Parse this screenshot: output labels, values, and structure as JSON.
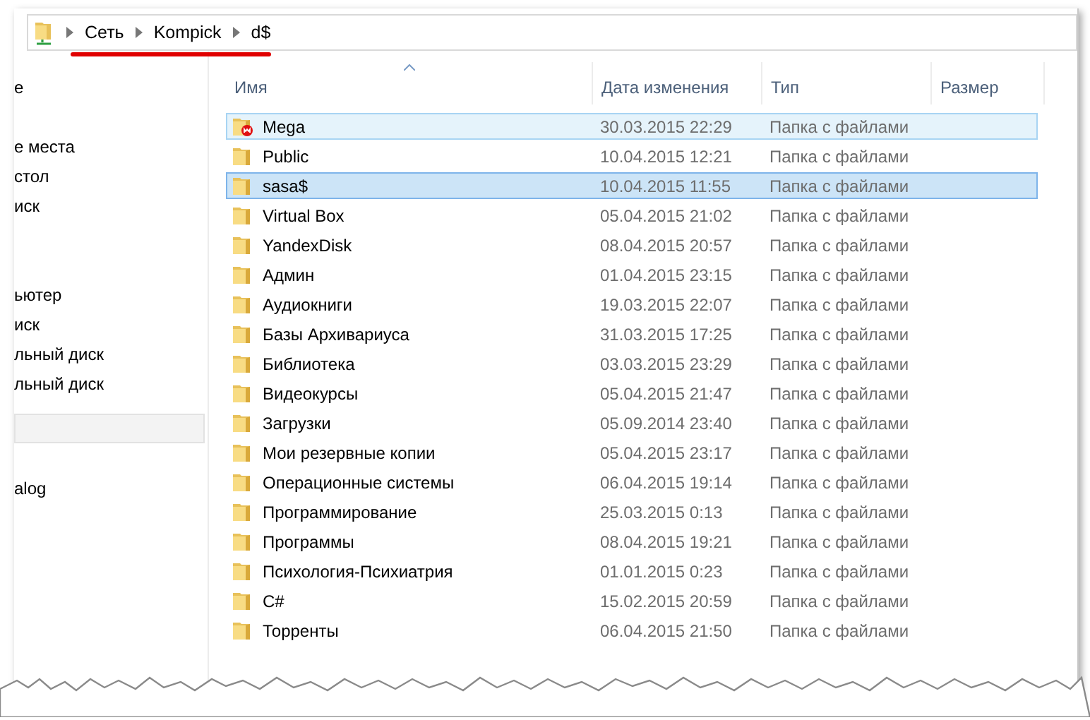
{
  "address_bar": {
    "path": [
      "Сеть",
      "Kompick",
      "d$"
    ]
  },
  "navigation": {
    "items": [
      {
        "label": "е"
      },
      {
        "label": "е места"
      },
      {
        "label": "стол"
      },
      {
        "label": "иск"
      },
      {
        "label": "ьютер"
      },
      {
        "label": "иск"
      },
      {
        "label": "льный диск"
      },
      {
        "label": "льный диск"
      },
      {
        "label": "alog"
      }
    ]
  },
  "table": {
    "columns": [
      {
        "label": "Имя",
        "sorted": true
      },
      {
        "label": "Дата изменения",
        "sorted": false
      },
      {
        "label": "Тип",
        "sorted": false
      },
      {
        "label": "Размер",
        "sorted": false
      }
    ],
    "rows": [
      {
        "name": "Mega",
        "date": "30.03.2015 22:29",
        "type": "Папка с файлами",
        "selected": false,
        "hovered": true,
        "overlay": true
      },
      {
        "name": "Public",
        "date": "10.04.2015 12:21",
        "type": "Папка с файлами",
        "selected": false,
        "hovered": false,
        "overlay": false
      },
      {
        "name": "sasa$",
        "date": "10.04.2015 11:55",
        "type": "Папка с файлами",
        "selected": true,
        "hovered": false,
        "overlay": false
      },
      {
        "name": "Virtual Box",
        "date": "05.04.2015 21:02",
        "type": "Папка с файлами",
        "selected": false,
        "hovered": false,
        "overlay": false
      },
      {
        "name": "YandexDisk",
        "date": "08.04.2015 20:57",
        "type": "Папка с файлами",
        "selected": false,
        "hovered": false,
        "overlay": false
      },
      {
        "name": "Админ",
        "date": "01.04.2015 23:15",
        "type": "Папка с файлами",
        "selected": false,
        "hovered": false,
        "overlay": false
      },
      {
        "name": "Аудиокниги",
        "date": "19.03.2015 22:07",
        "type": "Папка с файлами",
        "selected": false,
        "hovered": false,
        "overlay": false
      },
      {
        "name": "Базы Архивариуса",
        "date": "31.03.2015 17:25",
        "type": "Папка с файлами",
        "selected": false,
        "hovered": false,
        "overlay": false
      },
      {
        "name": "Библиотека",
        "date": "03.03.2015 23:29",
        "type": "Папка с файлами",
        "selected": false,
        "hovered": false,
        "overlay": false
      },
      {
        "name": "Видеокурсы",
        "date": "05.04.2015 21:47",
        "type": "Папка с файлами",
        "selected": false,
        "hovered": false,
        "overlay": false
      },
      {
        "name": "Загрузки",
        "date": "05.09.2014 23:40",
        "type": "Папка с файлами",
        "selected": false,
        "hovered": false,
        "overlay": false
      },
      {
        "name": "Мои резервные копии",
        "date": "05.04.2015 23:17",
        "type": "Папка с файлами",
        "selected": false,
        "hovered": false,
        "overlay": false
      },
      {
        "name": "Операционные системы",
        "date": "06.04.2015 19:14",
        "type": "Папка с файлами",
        "selected": false,
        "hovered": false,
        "overlay": false
      },
      {
        "name": "Программирование",
        "date": "25.03.2015 0:13",
        "type": "Папка с файлами",
        "selected": false,
        "hovered": false,
        "overlay": false
      },
      {
        "name": "Программы",
        "date": "08.04.2015 19:21",
        "type": "Папка с файлами",
        "selected": false,
        "hovered": false,
        "overlay": false
      },
      {
        "name": "Психология-Психиатрия",
        "date": "01.01.2015 0:23",
        "type": "Папка с файлами",
        "selected": false,
        "hovered": false,
        "overlay": false
      },
      {
        "name": "C#",
        "date": "15.02.2015 20:59",
        "type": "Папка с файлами",
        "selected": false,
        "hovered": false,
        "overlay": false
      },
      {
        "name": "Торренты",
        "date": "06.04.2015 21:50",
        "type": "Папка с файлами",
        "selected": false,
        "hovered": false,
        "overlay": false
      }
    ]
  }
}
